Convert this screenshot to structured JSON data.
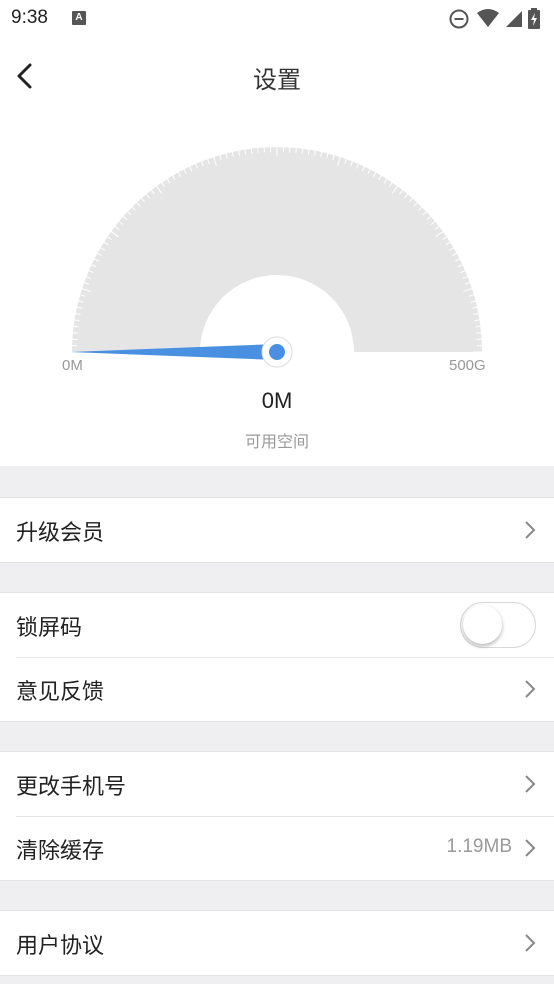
{
  "status_bar": {
    "time": "9:38",
    "notification_icon": "A",
    "icons": [
      "do-not-disturb-icon",
      "wifi-icon",
      "signal-icon",
      "battery-charging-icon"
    ]
  },
  "header": {
    "title": "设置",
    "back_icon": "chevron-left-icon"
  },
  "storage_gauge": {
    "min_label": "0M",
    "max_label": "500G",
    "value": "0M",
    "caption": "可用空间",
    "fill_fraction": 0,
    "accent_color": "#4a90e2"
  },
  "settings": {
    "upgrade_member": "升级会员",
    "lock_screen_code": "锁屏码",
    "lock_screen_enabled": false,
    "feedback": "意见反馈",
    "change_phone": "更改手机号",
    "clear_cache": "清除缓存",
    "cache_size": "1.19MB",
    "user_agreement": "用户协议"
  },
  "colors": {
    "section_background": "#efeff1",
    "gauge_arc": "#e5e5e5",
    "accent": "#4a90e2"
  }
}
